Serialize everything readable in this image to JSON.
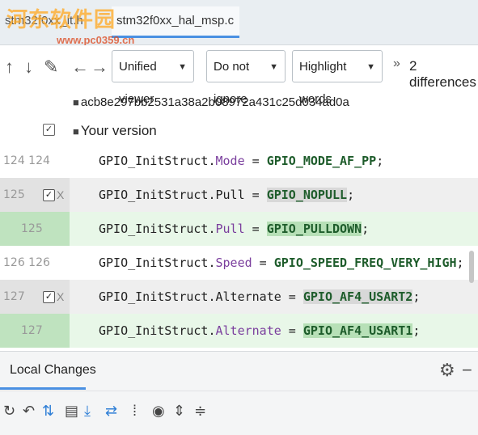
{
  "tabs": [
    {
      "label": "stm32f0xx_it.h"
    },
    {
      "label": "stm32f0xx_hal_msp.c",
      "close": "✕"
    }
  ],
  "watermark": {
    "line1": "河东软件园",
    "line2": "www.pc0359.cn"
  },
  "toolbar": {
    "viewer": "Unified viewer",
    "ignore": "Do not ignore",
    "highlight": "Highlight words",
    "differences": "2 differences"
  },
  "header": {
    "hash": "acb8e297bb2531a38a2b08972a431c25d034ad0a",
    "your_version": "Your version"
  },
  "rows": [
    {
      "nums": "124 124",
      "prefix": "GPIO_InitStruct.",
      "prop": "Mode",
      "eq": " = ",
      "val": "GPIO_MODE_AF_PP",
      "end": ";"
    },
    {
      "nums": "125",
      "prefix": "GPIO_InitStruct.Pull = ",
      "val": "GPIO_NOPULL",
      "end": ";"
    },
    {
      "nums": "125",
      "prefix": "GPIO_InitStruct.",
      "prop": "Pull",
      "eq": " = ",
      "val": "GPIO_PULLDOWN",
      "end": ";"
    },
    {
      "nums": "126 126",
      "prefix": "GPIO_InitStruct.",
      "prop": "Speed",
      "eq": " = ",
      "val": "GPIO_SPEED_FREQ_VERY_HIGH",
      "end": ";"
    },
    {
      "nums": "127",
      "prefix": "GPIO_InitStruct.Alternate = ",
      "val": "GPIO_AF4_USART2",
      "end": ";"
    },
    {
      "nums": "127",
      "prefix": "GPIO_InitStruct.",
      "prop": "Alternate",
      "eq": " = ",
      "val": "GPIO_AF4_USART1",
      "end": ";"
    }
  ],
  "bottom": {
    "local_changes": "Local Changes"
  },
  "icons": {
    "up": "↑",
    "down": "↓",
    "edit": "✎",
    "left": "←",
    "right": "→",
    "chevron": "»",
    "lock": "🔒",
    "check": "✓",
    "x": "X",
    "gear": "⚙",
    "minus": "−"
  }
}
